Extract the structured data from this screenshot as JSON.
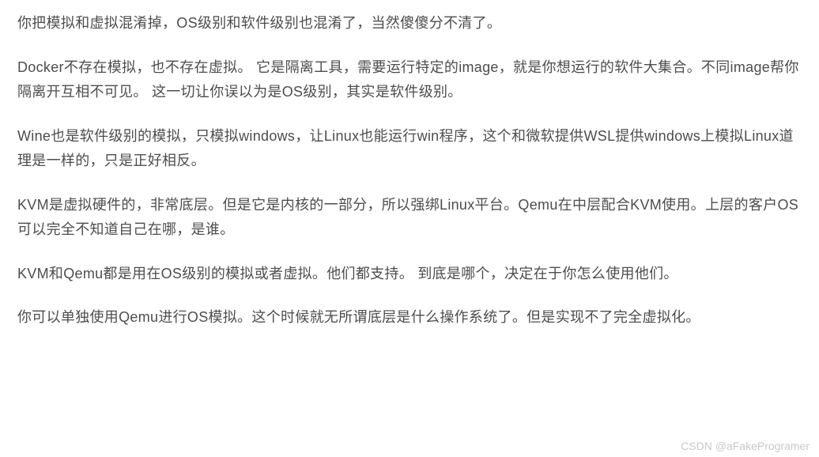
{
  "paragraphs": [
    "你把模拟和虚拟混淆掉，OS级别和软件级别也混淆了，当然傻傻分不清了。",
    "Docker不存在模拟，也不存在虚拟。 它是隔离工具，需要运行特定的image，就是你想运行的软件大集合。不同image帮你隔离开互相不可见。 这一切让你误以为是OS级别，其实是软件级别。",
    "Wine也是软件级别的模拟，只模拟windows，让Linux也能运行win程序，这个和微软提供WSL提供windows上模拟Linux道理是一样的，只是正好相反。",
    "KVM是虚拟硬件的，非常底层。但是它是内核的一部分，所以强绑Linux平台。Qemu在中层配合KVM使用。上层的客户OS可以完全不知道自己在哪，是谁。",
    "KVM和Qemu都是用在OS级别的模拟或者虚拟。他们都支持。 到底是哪个，决定在于你怎么使用他们。",
    "你可以单独使用Qemu进行OS模拟。这个时候就无所谓底层是什么操作系统了。但是实现不了完全虚拟化。"
  ],
  "watermark": "CSDN @aFakeProgramer"
}
